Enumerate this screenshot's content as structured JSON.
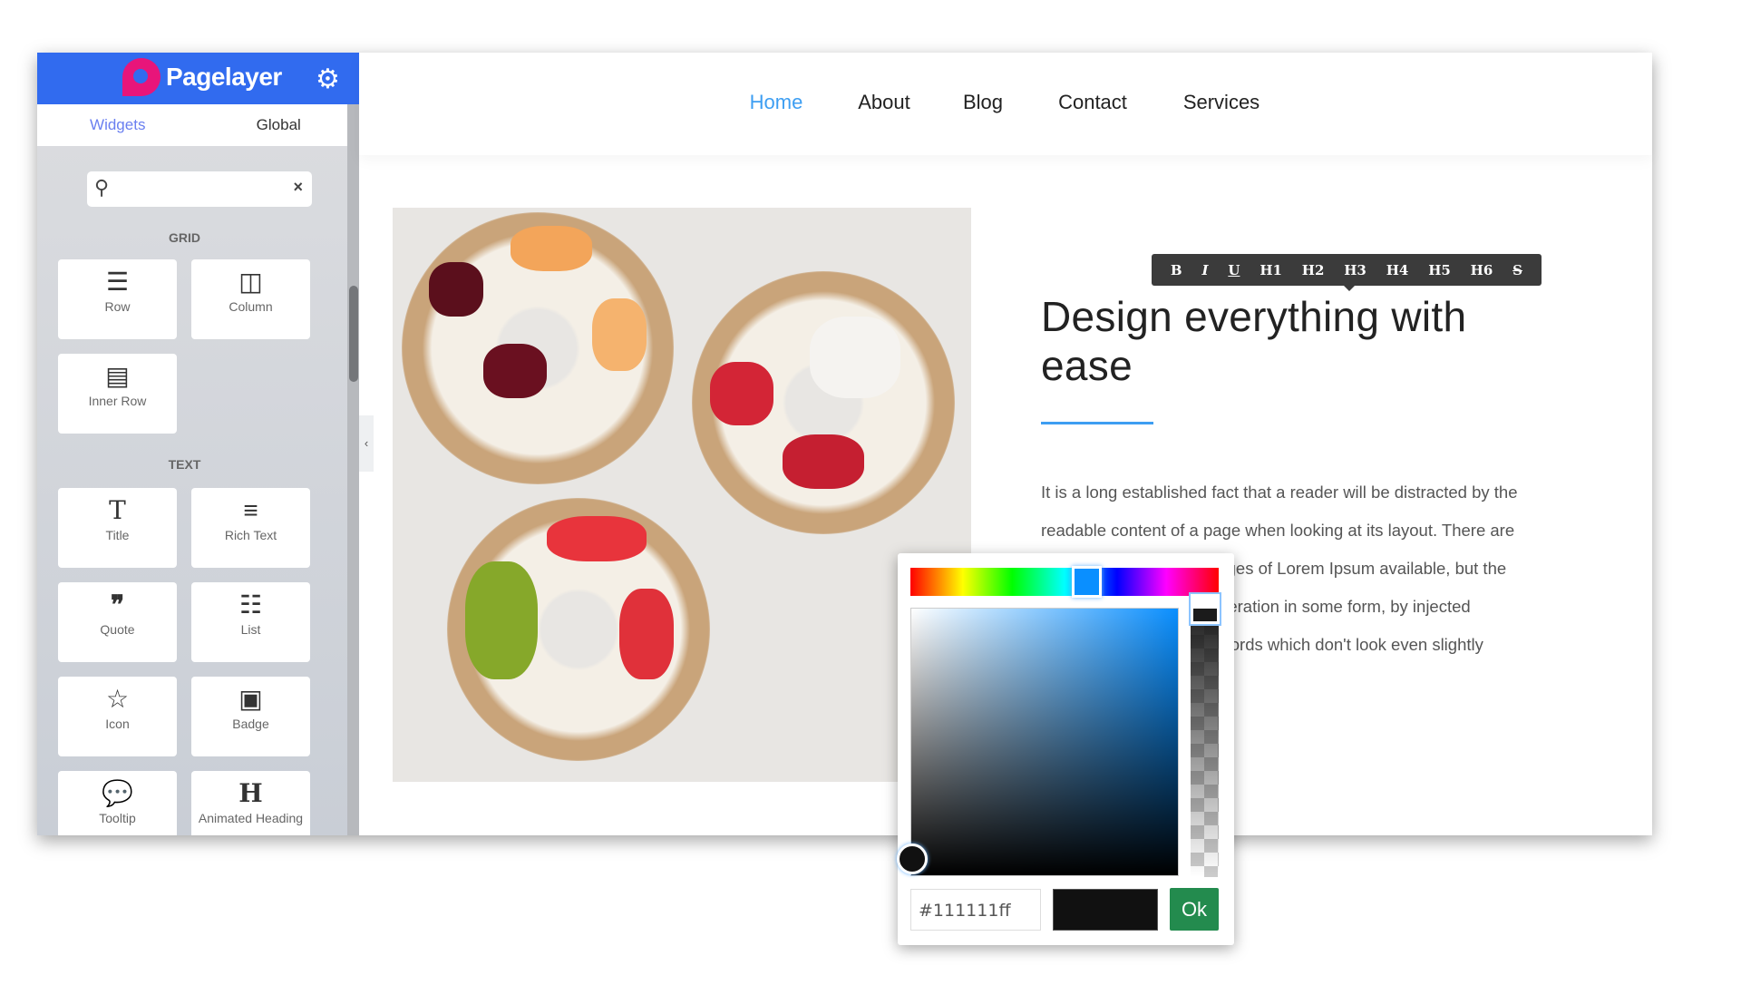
{
  "sidebar": {
    "brand": "Pagelayer",
    "tabs": [
      {
        "label": "Widgets",
        "active": true
      },
      {
        "label": "Global",
        "active": false
      }
    ],
    "search": {
      "value": "",
      "placeholder": ""
    },
    "sections": [
      {
        "label": "GRID",
        "items": [
          {
            "label": "Row",
            "icon": "bars-icon"
          },
          {
            "label": "Column",
            "icon": "columns-icon"
          },
          {
            "label": "Inner Row",
            "icon": "table-icon"
          }
        ]
      },
      {
        "label": "TEXT",
        "items": [
          {
            "label": "Title",
            "icon": "title-t-icon"
          },
          {
            "label": "Rich Text",
            "icon": "align-left-icon"
          },
          {
            "label": "Quote",
            "icon": "quote-icon"
          },
          {
            "label": "List",
            "icon": "list-icon"
          },
          {
            "label": "Icon",
            "icon": "star-icon"
          },
          {
            "label": "Badge",
            "icon": "badge-icon"
          },
          {
            "label": "Tooltip",
            "icon": "comment-dots-icon"
          },
          {
            "label": "Animated Heading",
            "icon": "heading-h-icon"
          }
        ]
      }
    ]
  },
  "nav": {
    "items": [
      {
        "label": "Home",
        "active": true
      },
      {
        "label": "About"
      },
      {
        "label": "Blog"
      },
      {
        "label": "Contact"
      },
      {
        "label": "Services"
      }
    ]
  },
  "toolbar": [
    "B",
    "I",
    "U",
    "H1",
    "H2",
    "H3",
    "H4",
    "H5",
    "H6",
    "S"
  ],
  "content": {
    "heading_lines": [
      "Design everything with",
      "ease"
    ],
    "paragraph_lines": [
      "It is a long established fact that a reader will be distracted by the",
      "readable content of a page when looking at its layout. There are",
      "many variations of passages of Lorem Ipsum available, but the",
      "majority have suffered alteration in some form, by injected",
      "humour, or randomised words which don't look even slightly"
    ]
  },
  "color_picker": {
    "hex_value": "#111111ff",
    "ok_label": "Ok",
    "hue_color": "#0a8fff",
    "selected_color": "#111111"
  },
  "colors": {
    "brand": "#316bef",
    "accent": "#3d9ef2",
    "ok": "#238b4e",
    "logo": "#e8157a"
  }
}
